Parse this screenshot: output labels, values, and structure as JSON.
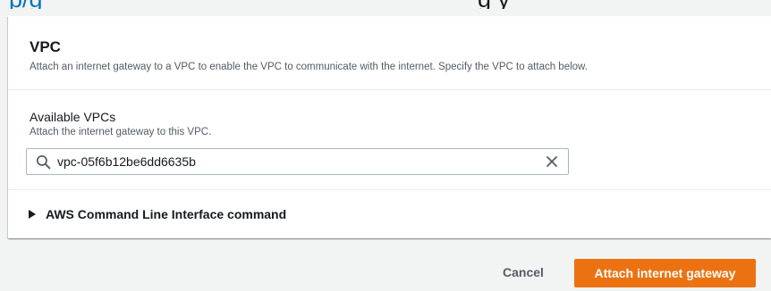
{
  "colors": {
    "accent": "#ec7211",
    "link": "#0073bb",
    "page_background": "#f2f3f3",
    "card_background": "#ffffff",
    "text": "#16191f",
    "secondary_text": "#545b64"
  },
  "card": {
    "title": "VPC",
    "description": "Attach an internet gateway to a VPC to enable the VPC to communicate with the internet. Specify the VPC to attach below."
  },
  "vpc_field": {
    "label": "Available VPCs",
    "help": "Attach the internet gateway to this VPC.",
    "value": "vpc-05f6b12be6dd6635b",
    "search_icon": "search-icon",
    "clear_icon": "close-icon"
  },
  "cli_section": {
    "label": "AWS Command Line Interface command",
    "icon": "caret-right-icon"
  },
  "actions": {
    "cancel_label": "Cancel",
    "submit_label": "Attach internet gateway"
  }
}
